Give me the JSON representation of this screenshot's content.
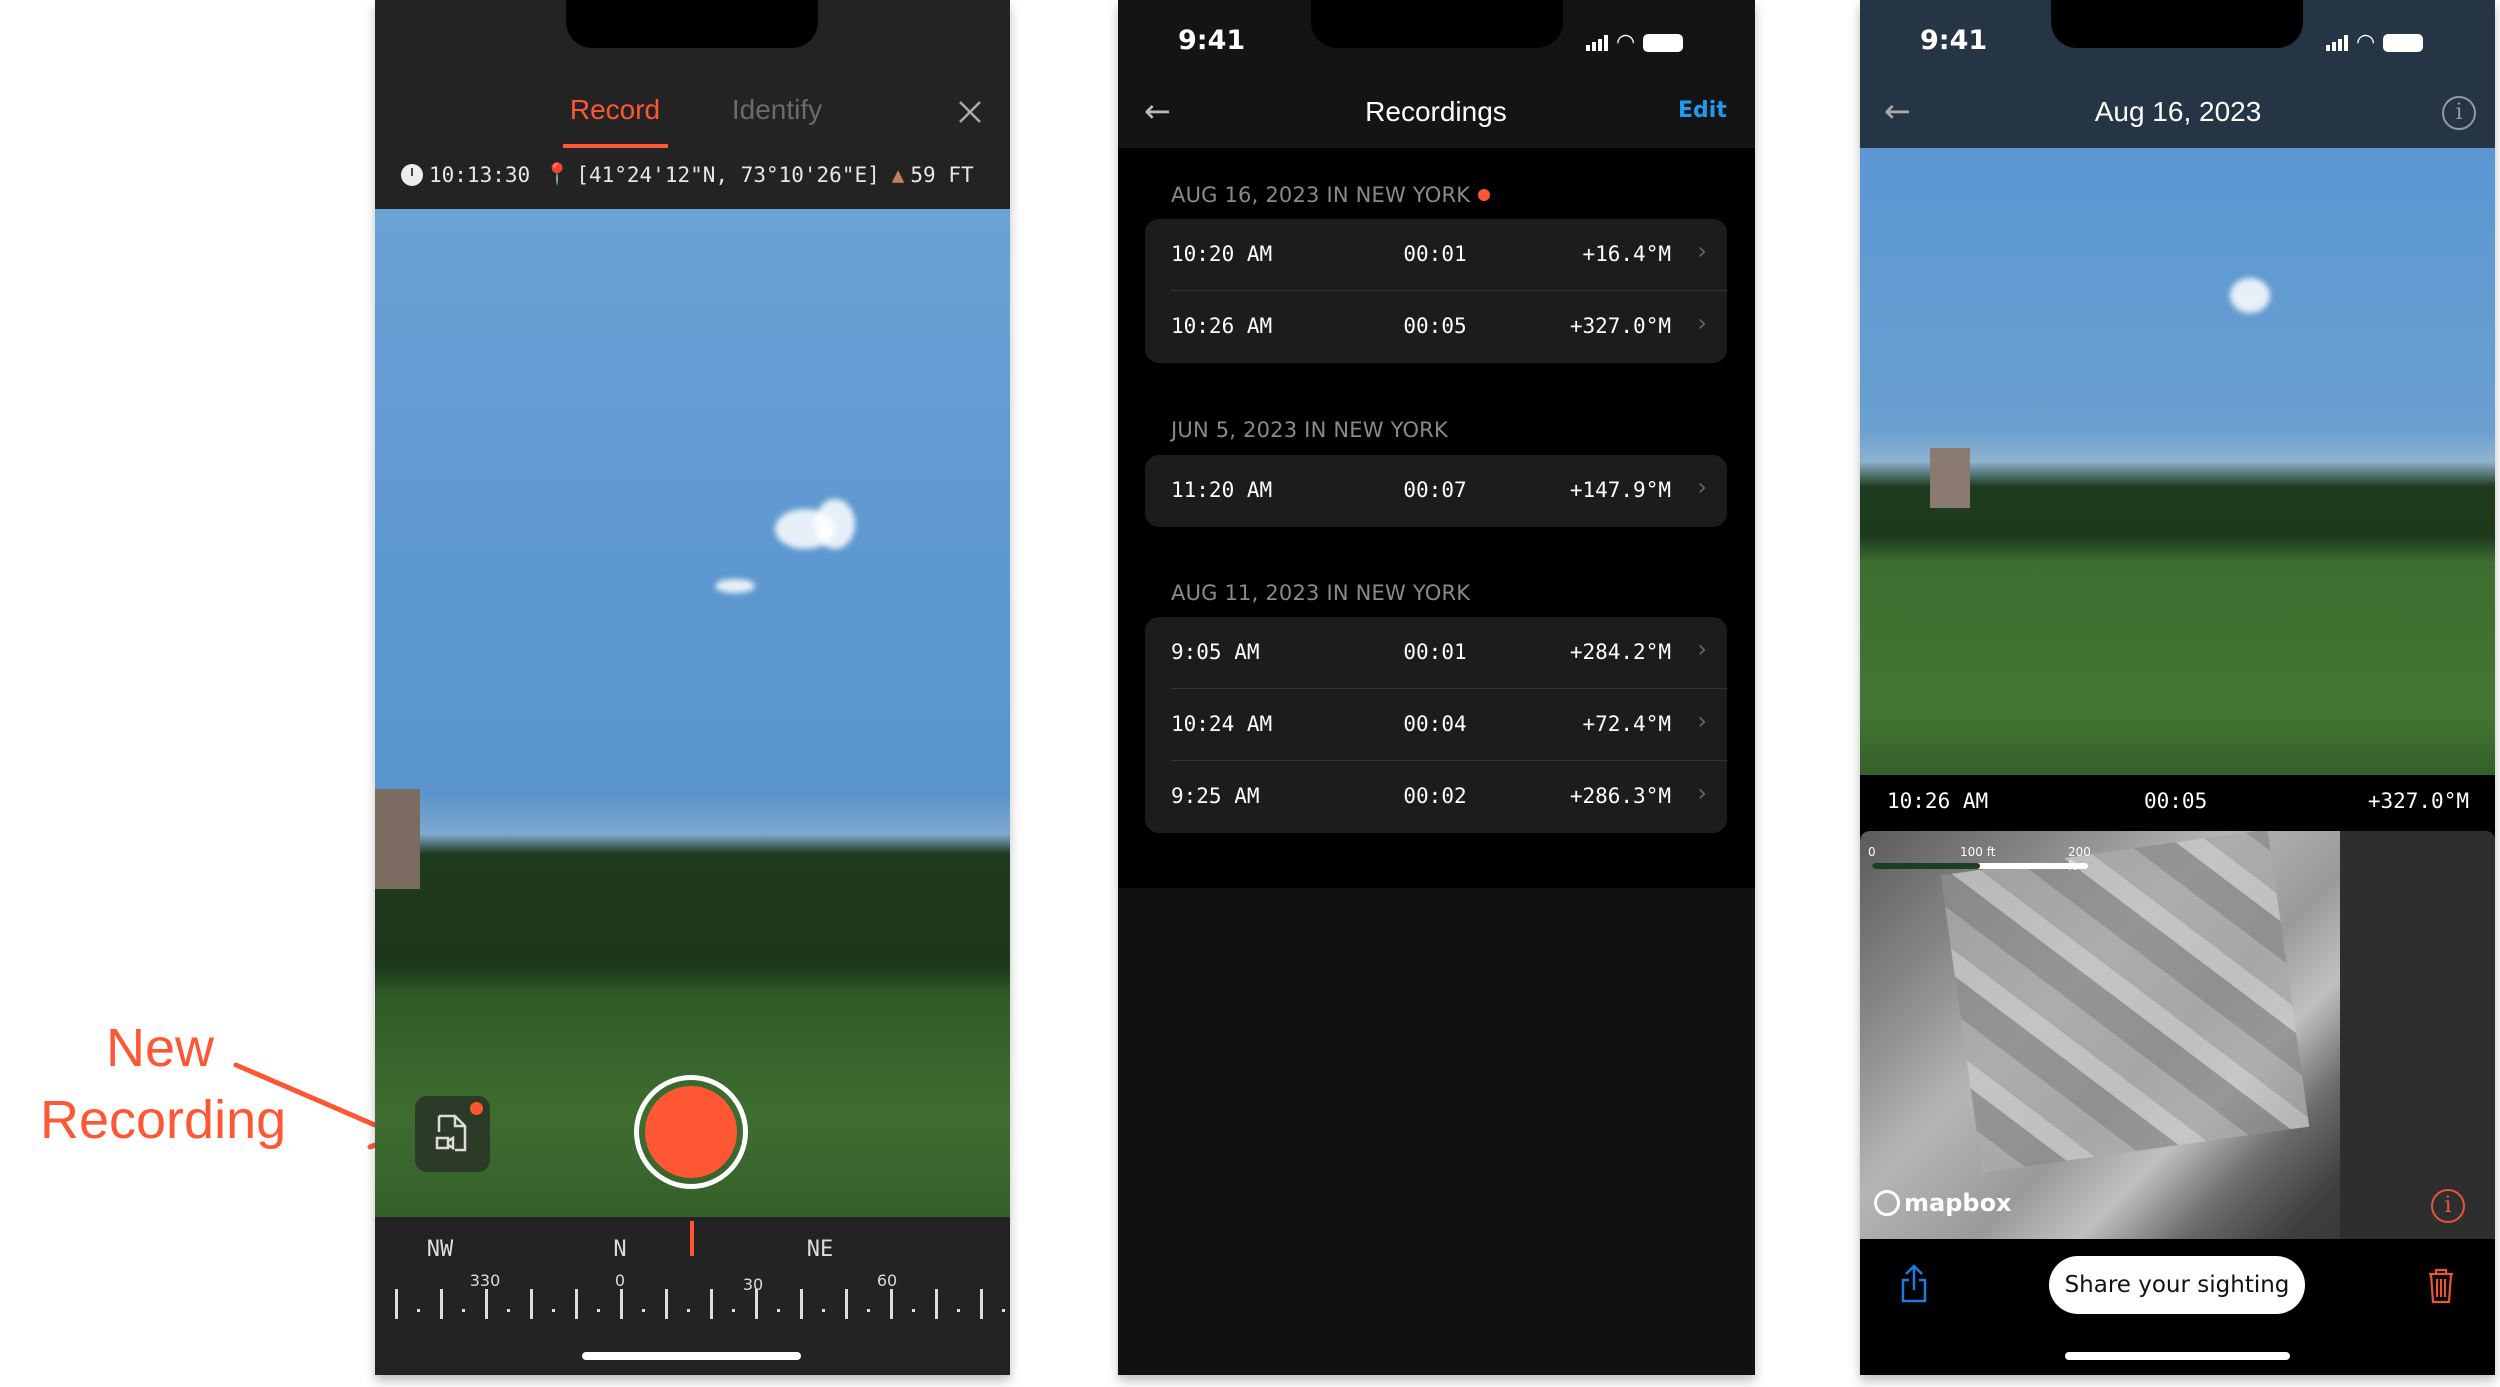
{
  "annotation": {
    "line1": "New",
    "line2": "Recording",
    "color": "#ff5733"
  },
  "record_screen": {
    "tabs": [
      {
        "label": "Record",
        "active": true
      },
      {
        "label": "Identify",
        "active": false
      }
    ],
    "close_icon": "close-icon",
    "info": {
      "time": "10:13:30",
      "coords": "[41°24'12\"N, 73°10'26\"E]",
      "altitude": "59 FT"
    },
    "compass": {
      "directions": [
        "NW",
        "N",
        "NE"
      ],
      "degrees": [
        "330",
        "0",
        "30",
        "60"
      ]
    },
    "accent": "#ff5733"
  },
  "recordings_screen": {
    "status_time": "9:41",
    "title": "Recordings",
    "edit_label": "Edit",
    "edit_color": "#1e9bf0",
    "sections": [
      {
        "header": "AUG 16, 2023 IN NEW YORK",
        "new": true,
        "rows": [
          {
            "time": "10:20 AM",
            "duration": "00:01",
            "angle": "+16.4°M"
          },
          {
            "time": "10:26 AM",
            "duration": "00:05",
            "angle": "+327.0°M"
          }
        ]
      },
      {
        "header": "JUN 5, 2023 IN NEW YORK",
        "new": false,
        "rows": [
          {
            "time": "11:20 AM",
            "duration": "00:07",
            "angle": "+147.9°M"
          }
        ]
      },
      {
        "header": "AUG 11, 2023 IN NEW YORK",
        "new": false,
        "rows": [
          {
            "time": "9:05 AM",
            "duration": "00:01",
            "angle": "+284.2°M"
          },
          {
            "time": "10:24 AM",
            "duration": "00:04",
            "angle": "+72.4°M"
          },
          {
            "time": "9:25 AM",
            "duration": "00:02",
            "angle": "+286.3°M"
          }
        ]
      }
    ]
  },
  "detail_screen": {
    "status_time": "9:41",
    "title": "Aug 16, 2023",
    "info_bar": {
      "time": "10:26 AM",
      "duration": "00:05",
      "angle": "+327.0°M"
    },
    "map": {
      "scale_labels": [
        "0",
        "100 ft",
        "200 ft"
      ],
      "attribution": "mapbox"
    },
    "share_button": "Share your sighting"
  }
}
